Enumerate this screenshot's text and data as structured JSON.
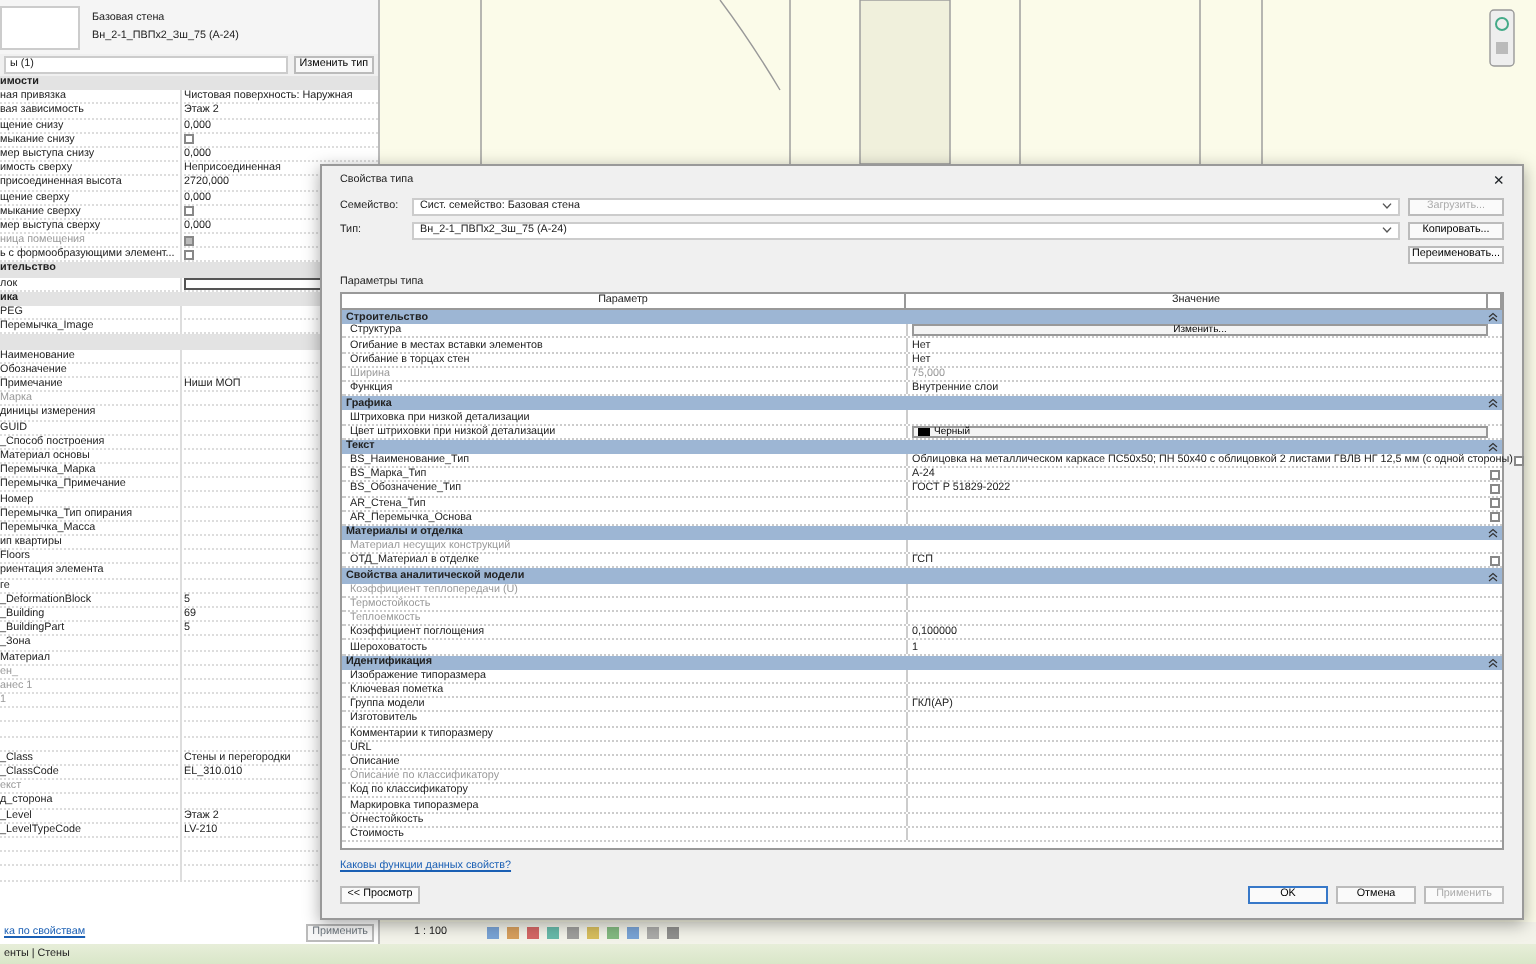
{
  "properties_panel": {
    "family": "Базовая стена",
    "type": "Вн_2-1_ПВПх2_Зш_75 (А-24)",
    "selector": "ы (1)",
    "edit_type_button": "Изменить тип",
    "rows": [
      {
        "kind": "group",
        "label": "имости"
      },
      {
        "kind": "row",
        "label": "ная привязка",
        "value": "Чистовая поверхность: Наружная",
        "disabled": false
      },
      {
        "kind": "row",
        "label": "вая зависимость",
        "value": "Этаж 2",
        "disabled": false
      },
      {
        "kind": "row",
        "label": "щение снизу",
        "value": "0,000",
        "disabled": false
      },
      {
        "kind": "check",
        "label": "мыкание снизу",
        "checked": false,
        "disabled": false
      },
      {
        "kind": "row",
        "label": "мер выступа снизу",
        "value": "0,000",
        "disabled": false
      },
      {
        "kind": "row",
        "label": "имость сверху",
        "value": "Неприсоединенная",
        "disabled": false
      },
      {
        "kind": "row",
        "label": "присоединенная высота",
        "value": "2720,000",
        "disabled": false
      },
      {
        "kind": "row",
        "label": "щение сверху",
        "value": "0,000",
        "disabled": false
      },
      {
        "kind": "check",
        "label": "мыкание сверху",
        "checked": false,
        "disabled": false
      },
      {
        "kind": "row",
        "label": "мер выступа сверху",
        "value": "0,000",
        "disabled": false
      },
      {
        "kind": "check",
        "label": "ница помещения",
        "checked": true,
        "disabled": true
      },
      {
        "kind": "check",
        "label": "ь с формообразующими элемент...",
        "checked": false,
        "disabled": false
      },
      {
        "kind": "group",
        "label": "ительство"
      },
      {
        "kind": "input",
        "label": "лок"
      },
      {
        "kind": "group",
        "label": "ика"
      },
      {
        "kind": "row",
        "label": "PEG",
        "disabled": false
      },
      {
        "kind": "row",
        "label": "Перемычка_Image",
        "disabled": false
      },
      {
        "kind": "group",
        "label": ""
      },
      {
        "kind": "row",
        "label": "Наименование",
        "disabled": false
      },
      {
        "kind": "row",
        "label": "Обозначение",
        "disabled": false
      },
      {
        "kind": "row",
        "label": "Примечание",
        "value": "Ниши МОП",
        "disabled": false
      },
      {
        "kind": "row",
        "label": "Марка",
        "disabled": true
      },
      {
        "kind": "row",
        "label": "диницы измерения",
        "disabled": false
      },
      {
        "kind": "row",
        "label": "GUID",
        "disabled": false
      },
      {
        "kind": "row",
        "label": "_Способ построения",
        "disabled": false
      },
      {
        "kind": "row",
        "label": "Материал основы",
        "disabled": false
      },
      {
        "kind": "row",
        "label": "Перемычка_Марка",
        "disabled": false
      },
      {
        "kind": "row",
        "label": "Перемычка_Примечание",
        "disabled": false
      },
      {
        "kind": "row",
        "label": "Номер",
        "disabled": false
      },
      {
        "kind": "row",
        "label": "Перемычка_Тип опирания",
        "disabled": false
      },
      {
        "kind": "row",
        "label": "Перемычка_Масса",
        "disabled": false
      },
      {
        "kind": "row",
        "label": "ип квартиры",
        "disabled": false
      },
      {
        "kind": "row",
        "label": "Floors",
        "disabled": false
      },
      {
        "kind": "row",
        "label": "риентация элемента",
        "disabled": false
      },
      {
        "kind": "row",
        "label": "ге",
        "disabled": false
      },
      {
        "kind": "row",
        "label": "_DeformationBlock",
        "value": "5",
        "disabled": false
      },
      {
        "kind": "row",
        "label": "_Building",
        "value": "69",
        "disabled": false
      },
      {
        "kind": "row",
        "label": "_BuildingPart",
        "value": "5",
        "disabled": false
      },
      {
        "kind": "row",
        "label": "_Зона",
        "disabled": false
      },
      {
        "kind": "row",
        "label": "Материал",
        "disabled": false
      },
      {
        "kind": "row",
        "label": "ен_",
        "disabled": true
      },
      {
        "kind": "row",
        "label": "анес 1",
        "disabled": true
      },
      {
        "kind": "row",
        "label": "1",
        "disabled": true
      },
      {
        "kind": "row"
      },
      {
        "kind": "row"
      },
      {
        "kind": "row"
      },
      {
        "kind": "row",
        "label": "_Class",
        "value": "Стены и перегородки",
        "disabled": false
      },
      {
        "kind": "row",
        "label": "_ClassCode",
        "value": "EL_310.010",
        "disabled": false
      },
      {
        "kind": "row",
        "label": "екст",
        "disabled": true
      },
      {
        "kind": "row",
        "label": "д_сторона",
        "disabled": false
      },
      {
        "kind": "row",
        "label": "_Level",
        "value": "Этаж 2",
        "disabled": false
      },
      {
        "kind": "row",
        "label": "_LevelTypeCode",
        "value": "LV-210",
        "disabled": false
      },
      {
        "kind": "row"
      },
      {
        "kind": "row"
      },
      {
        "kind": "row"
      }
    ],
    "help_link": "ка по свойствам",
    "apply_button": "Применить",
    "footer": "енты | Стены"
  },
  "status_bar": {
    "scale": "1 : 100"
  },
  "dialog": {
    "title": "Свойства типа",
    "close": "×",
    "family_label": "Семейство:",
    "family_value": "Сист. семейство: Базовая стена",
    "load_button": "Загрузить...",
    "load_disabled": true,
    "type_label": "Тип:",
    "type_value": "Вн_2-1_ПВПх2_Зш_75 (А-24)",
    "copy_button": "Копировать...",
    "rename_button": "Переименовать...",
    "section_title": "Параметры типа",
    "columns": [
      "Параметр",
      "Значение"
    ],
    "rows": [
      {
        "kind": "group",
        "label": "Строительство"
      },
      {
        "kind": "button",
        "label": "Структура",
        "value": "Изменить..."
      },
      {
        "kind": "row",
        "label": "Огибание в местах вставки элементов",
        "value": "Нет",
        "disabled": false,
        "box": false
      },
      {
        "kind": "row",
        "label": "Огибание в торцах стен",
        "value": "Нет",
        "disabled": false,
        "box": false
      },
      {
        "kind": "row",
        "label": "Ширина",
        "value": "75,000",
        "disabled": true,
        "box": false
      },
      {
        "kind": "row",
        "label": "Функция",
        "value": "Внутренние слои",
        "disabled": false,
        "box": false
      },
      {
        "kind": "group",
        "label": "Графика"
      },
      {
        "kind": "row",
        "label": "Штриховка при низкой детализации",
        "disabled": false,
        "box": false
      },
      {
        "kind": "color",
        "label": "Цвет штриховки при низкой детализации",
        "value": "Черный",
        "color": "#000000"
      },
      {
        "kind": "group",
        "label": "Текст"
      },
      {
        "kind": "row",
        "label": "BS_Наименование_Тип",
        "value": "Облицовка на металлическом каркасе ПС50х50; ПН 50х40 с облицовкой 2 листами ГВЛВ НГ 12,5 мм (с одной стороны)",
        "disabled": false,
        "box": true,
        "checked": false
      },
      {
        "kind": "row",
        "label": "BS_Марка_Тип",
        "value": "А-24",
        "disabled": false,
        "box": true,
        "checked": false
      },
      {
        "kind": "row",
        "label": "BS_Обозначение_Тип",
        "value": "ГОСТ Р 51829-2022",
        "disabled": false,
        "box": true,
        "checked": false
      },
      {
        "kind": "row",
        "label": "AR_Стена_Тип",
        "disabled": false,
        "box": true,
        "checked": false
      },
      {
        "kind": "row",
        "label": "AR_Перемычка_Основа",
        "disabled": false,
        "box": true,
        "checked": false
      },
      {
        "kind": "group",
        "label": "Материалы и отделка"
      },
      {
        "kind": "row",
        "label": "Материал несущих конструкций",
        "disabled": true,
        "box": false
      },
      {
        "kind": "row",
        "label": "ОТД_Материал в отделке",
        "value": "ГСП",
        "disabled": false,
        "box": true,
        "checked": false
      },
      {
        "kind": "group",
        "label": "Свойства аналитической модели"
      },
      {
        "kind": "row",
        "label": "Коэффициент теплопередачи (U)",
        "disabled": true,
        "box": false
      },
      {
        "kind": "row",
        "label": "Термостойкость",
        "disabled": true,
        "box": false
      },
      {
        "kind": "row",
        "label": "Теплоемкость",
        "disabled": true,
        "box": false
      },
      {
        "kind": "row",
        "label": "Коэффициент поглощения",
        "value": "0,100000",
        "disabled": false,
        "box": false
      },
      {
        "kind": "row",
        "label": "Шероховатость",
        "value": "1",
        "disabled": false,
        "box": false
      },
      {
        "kind": "group",
        "label": "Идентификация"
      },
      {
        "kind": "row",
        "label": "Изображение типоразмера",
        "disabled": false,
        "box": false
      },
      {
        "kind": "row",
        "label": "Ключевая пометка",
        "disabled": false,
        "box": false
      },
      {
        "kind": "row",
        "label": "Группа модели",
        "value": "ГКЛ(АР)",
        "disabled": false,
        "box": false
      },
      {
        "kind": "row",
        "label": "Изготовитель",
        "disabled": false,
        "box": false
      },
      {
        "kind": "row",
        "label": "Комментарии к типоразмеру",
        "disabled": false,
        "box": false
      },
      {
        "kind": "row",
        "label": "URL",
        "disabled": false,
        "box": false
      },
      {
        "kind": "row",
        "label": "Описание",
        "disabled": false,
        "box": false
      },
      {
        "kind": "row",
        "label": "Описание по классификатору",
        "disabled": true,
        "box": false
      },
      {
        "kind": "row",
        "label": "Код по классификатору",
        "disabled": false,
        "box": false
      },
      {
        "kind": "row",
        "label": "Маркировка типоразмера",
        "disabled": false,
        "box": false
      },
      {
        "kind": "row",
        "label": "Огнестойкость",
        "disabled": false,
        "box": false
      },
      {
        "kind": "row",
        "label": "Стоимость",
        "disabled": false,
        "box": false
      }
    ],
    "help_link": "Каковы функции данных свойств?",
    "preview_button": "<< Просмотр",
    "ok_button": "OK",
    "cancel_button": "Отмена",
    "apply_button": "Применить",
    "apply_disabled": true
  }
}
